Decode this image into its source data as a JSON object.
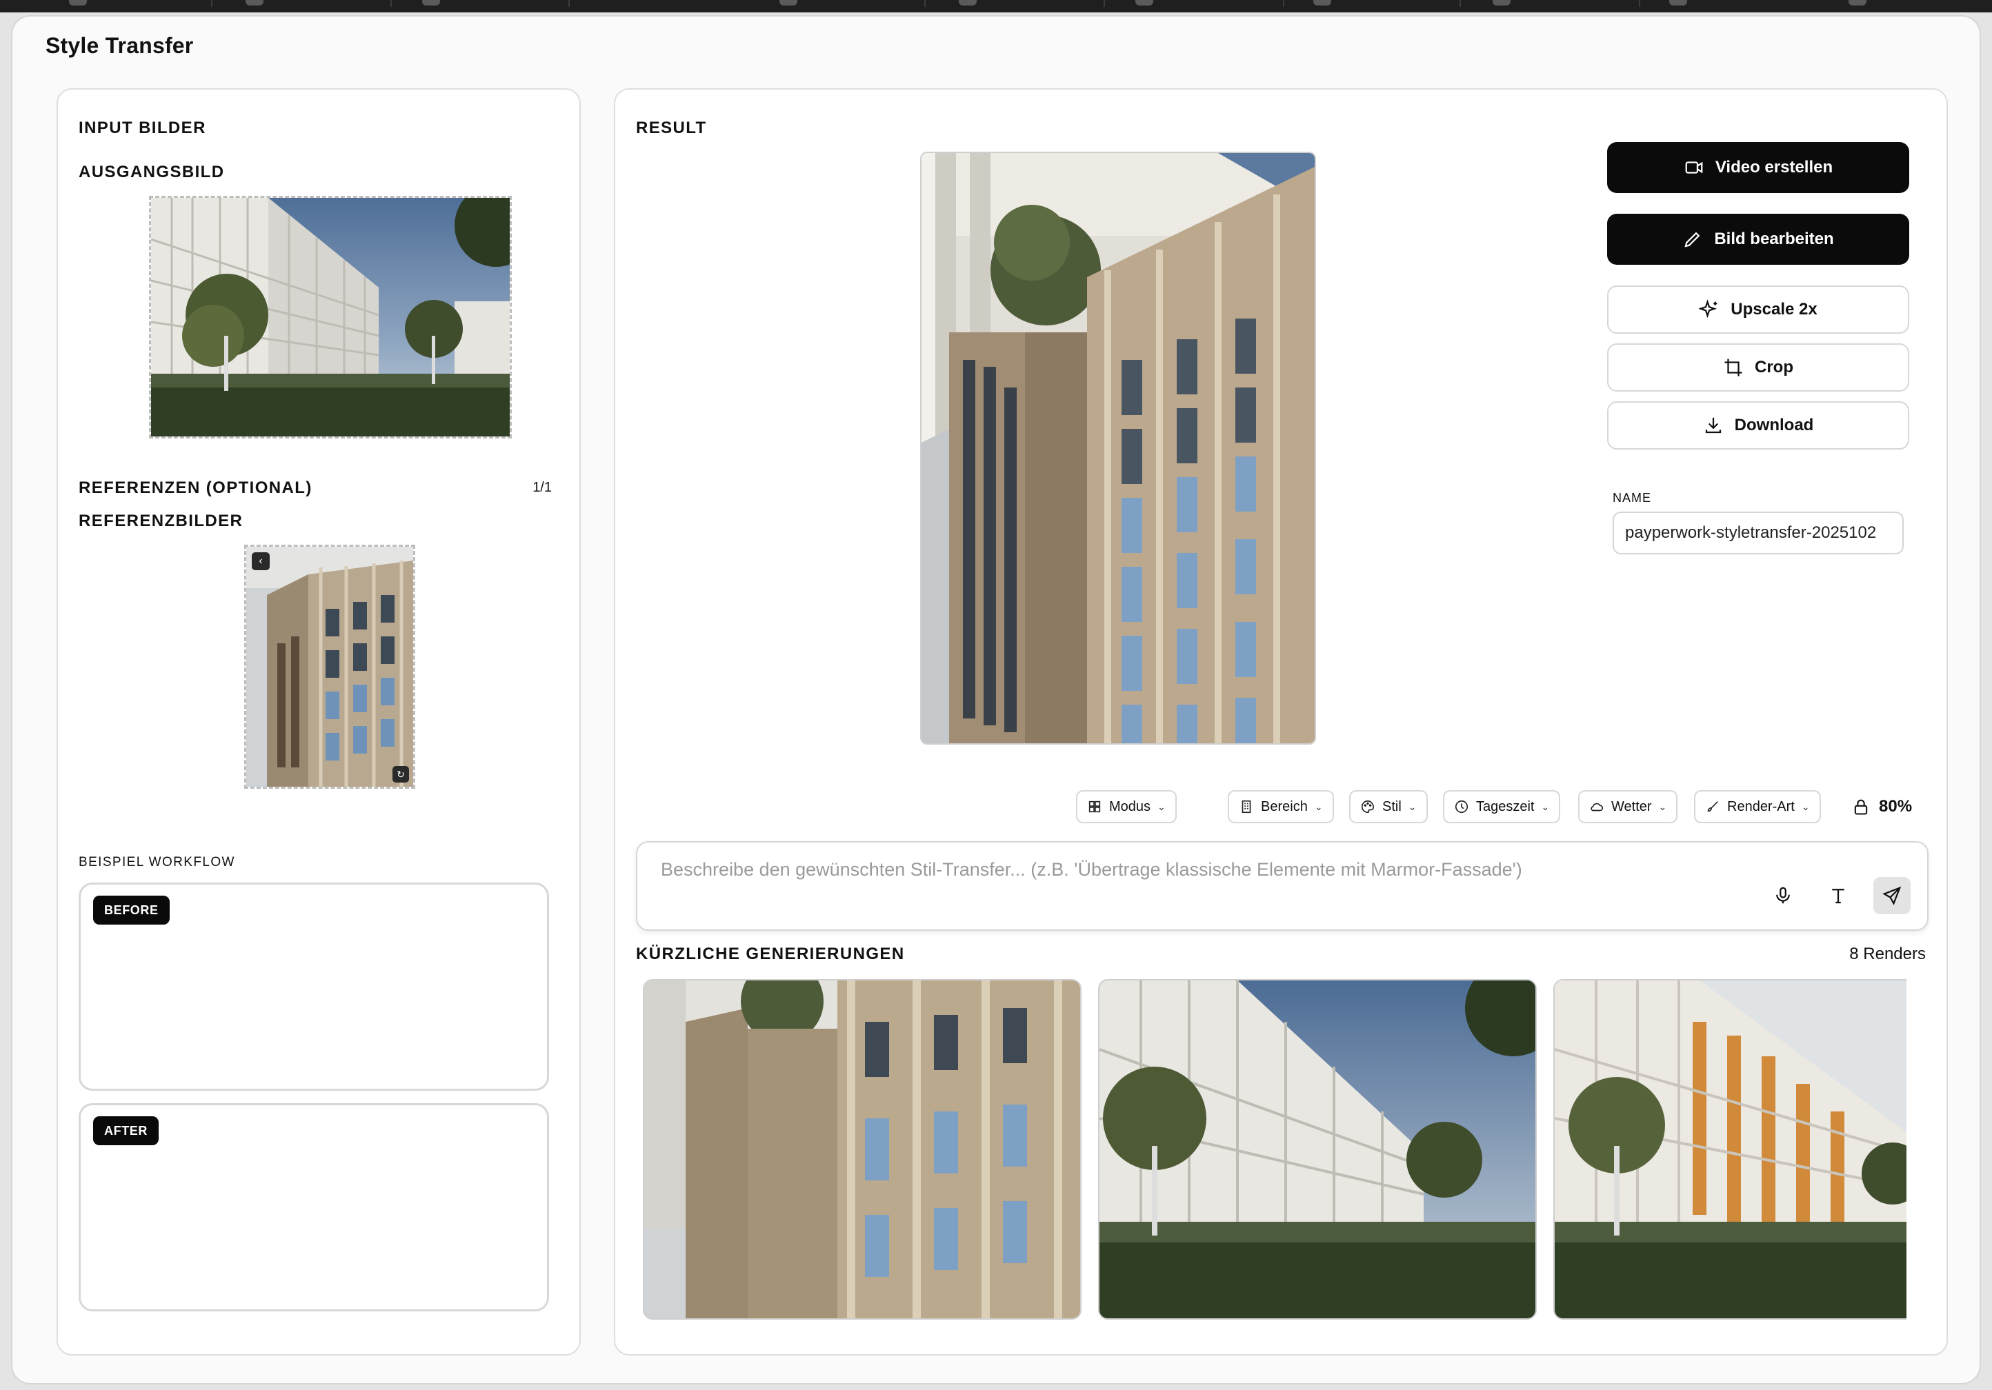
{
  "app": {
    "title": "Style Transfer"
  },
  "input_panel": {
    "header": "INPUT BILDER",
    "source_label": "AUSGANGSBILD",
    "references_label": "REFERENZEN (OPTIONAL)",
    "references_count": "1/1",
    "reference_images_label": "REFERENZBILDER",
    "workflow_label": "BEISPIEL WORKFLOW",
    "before_tag": "BEFORE",
    "after_tag": "AFTER"
  },
  "result_panel": {
    "header": "RESULT",
    "actions": {
      "video": "Video erstellen",
      "edit": "Bild bearbeiten",
      "upscale": "Upscale 2x",
      "crop": "Crop",
      "download": "Download"
    },
    "name_label": "NAME",
    "name_value": "payperwork-styletransfer-2025102",
    "chips": {
      "modus": "Modus",
      "bereich": "Bereich",
      "stil": "Stil",
      "tageszeit": "Tageszeit",
      "wetter": "Wetter",
      "render_art": "Render-Art"
    },
    "strength": "80%",
    "prompt_placeholder": "Beschreibe den gewünschten Stil-Transfer... (z.B. 'Übertrage klassische Elemente mit Marmor-Fassade')",
    "recent_label": "KÜRZLICHE GENERIERUNGEN",
    "recent_count": "8 Renders"
  },
  "colors": {
    "dark_button": "#0b0b0b",
    "panel_border": "#dedede",
    "placeholder": "#9a9a9a"
  },
  "icons": [
    "video-icon",
    "pencil-icon",
    "sparkles-icon",
    "crop-icon",
    "download-icon",
    "grid-icon",
    "building-icon",
    "palette-icon",
    "clock-icon",
    "cloud-icon",
    "brush-icon",
    "lock-icon",
    "microphone-icon",
    "text-icon",
    "send-icon",
    "chevron-left-icon",
    "refresh-icon"
  ]
}
